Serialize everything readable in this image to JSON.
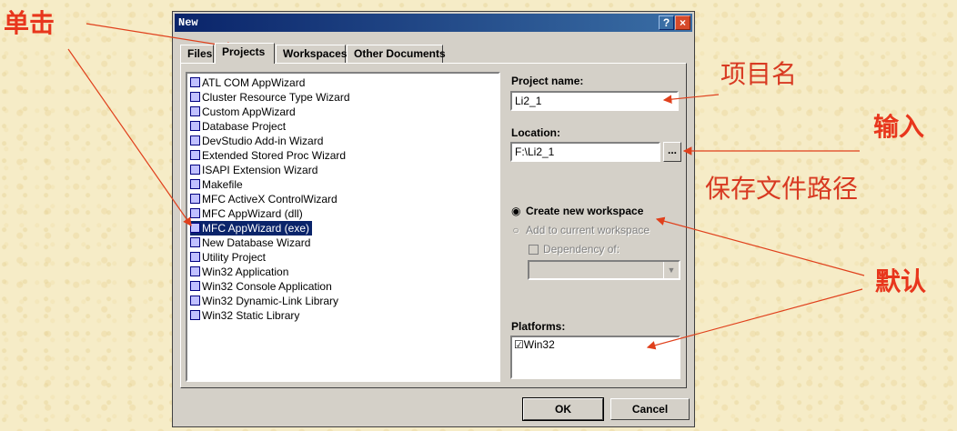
{
  "dialog": {
    "title": "New",
    "help_glyph": "?",
    "close_glyph": "×",
    "tabs": [
      {
        "label": "Files",
        "mnemonic": "",
        "active": false
      },
      {
        "label": "Projects",
        "mnemonic": "P",
        "active": true
      },
      {
        "label": "Workspaces",
        "mnemonic": "",
        "active": false
      },
      {
        "label": "Other Documents",
        "mnemonic": "",
        "active": false
      }
    ],
    "projects": [
      "ATL COM AppWizard",
      "Cluster Resource Type Wizard",
      "Custom AppWizard",
      "Database Project",
      "DevStudio Add-in Wizard",
      "Extended Stored Proc Wizard",
      "ISAPI Extension Wizard",
      "Makefile",
      "MFC ActiveX ControlWizard",
      "MFC AppWizard (dll)",
      "MFC AppWizard (exe)",
      "New Database Wizard",
      "Utility Project",
      "Win32 Application",
      "Win32 Console Application",
      "Win32 Dynamic-Link Library",
      "Win32 Static Library"
    ],
    "selected_project": "MFC AppWizard (exe)",
    "project_name_label": "Project name:",
    "project_name_value": "Li2_1",
    "location_label": "Location:",
    "location_value": "F:\\Li2_1",
    "browse_label": "...",
    "radio_create": "Create new workspace",
    "radio_add": "Add to current workspace",
    "dependency_label": "Dependency of:",
    "platforms_label": "Platforms:",
    "platform_item": "Win32",
    "check_glyph": "☑",
    "radio_on_glyph": "◉",
    "radio_off_glyph": "○",
    "combo_arrow": "▼",
    "ok_label": "OK",
    "cancel_label": "Cancel"
  },
  "annotations": {
    "click": "单击",
    "project_name": "项目名",
    "input": "输入",
    "save_path": "保存文件路径",
    "default": "默认"
  },
  "colors": {
    "annotation": "#e8361c",
    "arrow": "#e0401c",
    "titlebar": "#0a246a",
    "selection": "#0a246a"
  }
}
